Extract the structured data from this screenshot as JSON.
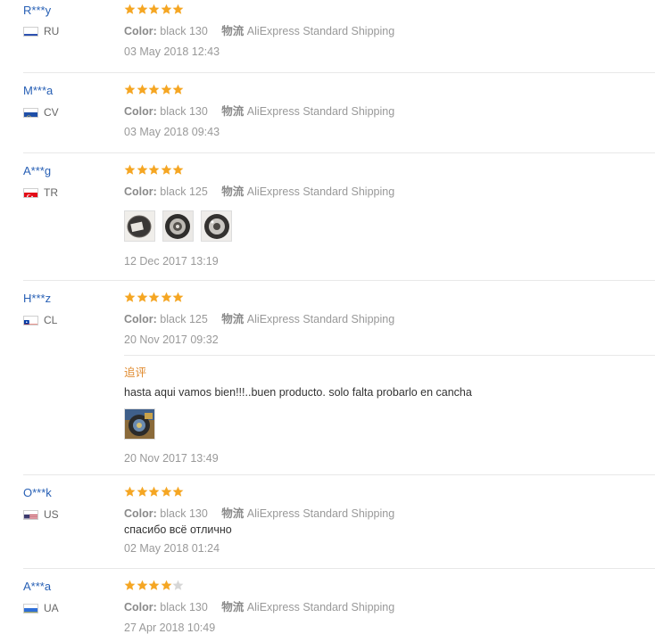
{
  "colors": {
    "star_on": "#f5a623",
    "star_off": "#d6d6d6",
    "link": "#2860b5",
    "followup": "#e08a2e"
  },
  "labels": {
    "color": "Color:",
    "shipping": "物流"
  },
  "reviews": [
    {
      "name": "R***y",
      "country": "RU",
      "rating": 5,
      "color_value": "black 130",
      "shipping": "AliExpress Standard Shipping",
      "date": "03 May 2018 12:43"
    },
    {
      "name": "M***a",
      "country": "CV",
      "rating": 5,
      "color_value": "black 130",
      "shipping": "AliExpress Standard Shipping",
      "date": "03 May 2018 09:43"
    },
    {
      "name": "A***g",
      "country": "TR",
      "rating": 5,
      "color_value": "black 125",
      "shipping": "AliExpress Standard Shipping",
      "date": "12 Dec 2017 13:19",
      "photos": 3
    },
    {
      "name": "H***z",
      "country": "CL",
      "rating": 5,
      "color_value": "black 125",
      "shipping": "AliExpress Standard Shipping",
      "date": "20 Nov 2017 09:32",
      "followup": {
        "label": "追评",
        "text": "hasta aqui vamos bien!!!..buen producto. solo falta probarlo en cancha",
        "date": "20 Nov 2017 13:49",
        "photos": 1
      }
    },
    {
      "name": "O***k",
      "country": "US",
      "rating": 5,
      "color_value": "black 130",
      "shipping": "AliExpress Standard Shipping",
      "comment": "спасибо всё отлично",
      "date": "02 May 2018 01:24"
    },
    {
      "name": "A***a",
      "country": "UA",
      "rating": 4,
      "color_value": "black 130",
      "shipping": "AliExpress Standard Shipping",
      "date": "27 Apr 2018 10:49"
    }
  ]
}
